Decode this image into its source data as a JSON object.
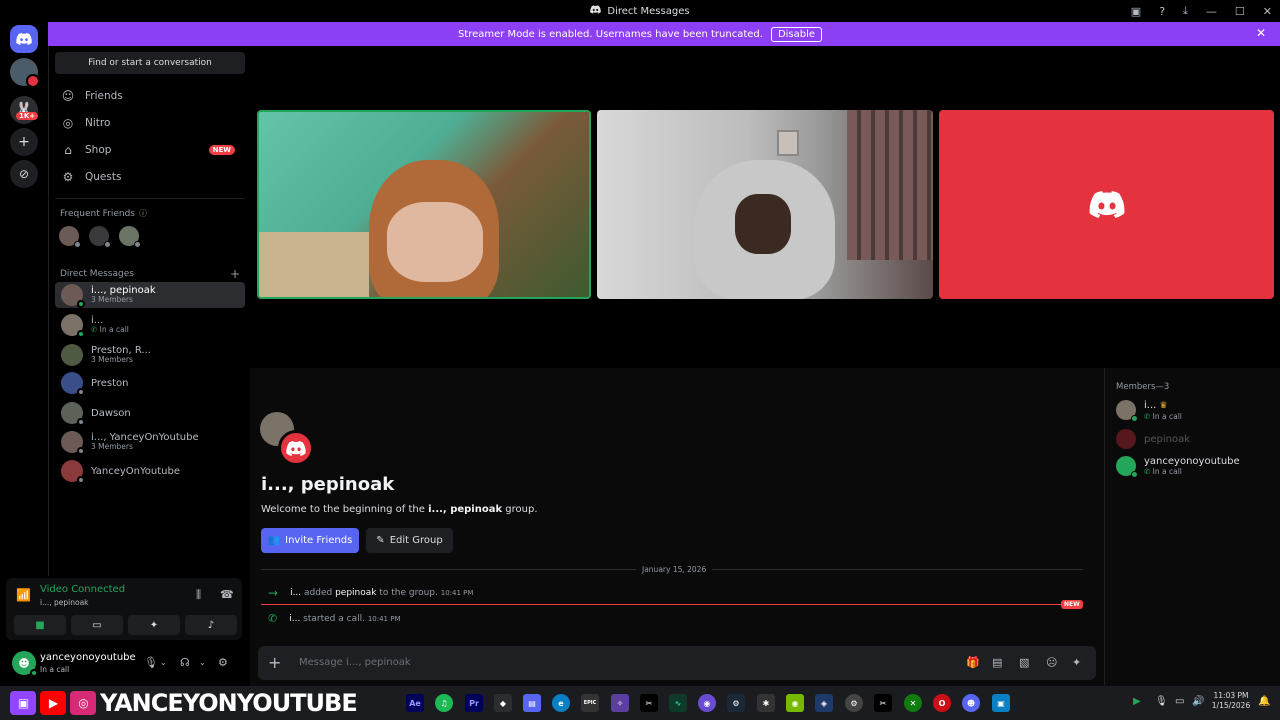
{
  "window": {
    "title": "Direct Messages"
  },
  "banner": {
    "text": "Streamer Mode is enabled. Usernames have been truncated.",
    "button": "Disable"
  },
  "rail": {
    "badge": "1K+"
  },
  "sidebar": {
    "search_placeholder": "Find or start a conversation",
    "nav": [
      {
        "label": "Friends",
        "icon": "friends-icon"
      },
      {
        "label": "Nitro",
        "icon": "nitro-icon"
      },
      {
        "label": "Shop",
        "icon": "shop-icon",
        "badge": "NEW"
      },
      {
        "label": "Quests",
        "icon": "quests-icon"
      }
    ],
    "frequent_friends_label": "Frequent Friends",
    "direct_messages_label": "Direct Messages",
    "dms": [
      {
        "name": "i..., pepinoak",
        "sub": "3 Members"
      },
      {
        "name": "i...",
        "sub": "In a call"
      },
      {
        "name": "Preston, R...",
        "sub": "3 Members"
      },
      {
        "name": "Preston",
        "sub": ""
      },
      {
        "name": "Dawson",
        "sub": ""
      },
      {
        "name": "i..., YanceyOnYoutube",
        "sub": "3 Members"
      },
      {
        "name": "YanceyOnYoutube",
        "sub": ""
      }
    ]
  },
  "voice": {
    "status": "Video Connected",
    "channel": "i..., pepinoak"
  },
  "user": {
    "name": "yanceyonoyoutube",
    "status": "In a call"
  },
  "chat": {
    "group_name": "i..., pepinoak",
    "welcome_prefix": "Welcome to the beginning of the ",
    "welcome_name": "i..., pepinoak",
    "welcome_suffix": " group.",
    "invite_button": "Invite Friends",
    "edit_button": "Edit Group",
    "date": "January 15, 2026",
    "messages": [
      {
        "actor": "i...",
        "text": " added ",
        "target": "pepinoak",
        "rest": " to the group.",
        "time": "10:41 PM"
      },
      {
        "actor": "i...",
        "text": " started a call.",
        "target": "",
        "rest": "",
        "time": "10:41 PM"
      }
    ],
    "new_tag": "NEW",
    "composer_placeholder": "Message i..., pepinoak"
  },
  "members": {
    "header": "Members—3",
    "list": [
      {
        "name": "i...",
        "sub": "In a call"
      },
      {
        "name": "pepinoak",
        "sub": ""
      },
      {
        "name": "yanceyonoyoutube",
        "sub": "In a call"
      }
    ]
  },
  "taskbar": {
    "brand": "YANCEYONYOUTUBE",
    "apps": [
      "Ae",
      "Pr",
      "EPIC"
    ],
    "time": "11:03 PM",
    "date": "1/15/2026"
  },
  "colors": {
    "accent": "#5865f2",
    "banner": "#8d3ff5",
    "online": "#23a55a",
    "danger": "#f23f43"
  }
}
